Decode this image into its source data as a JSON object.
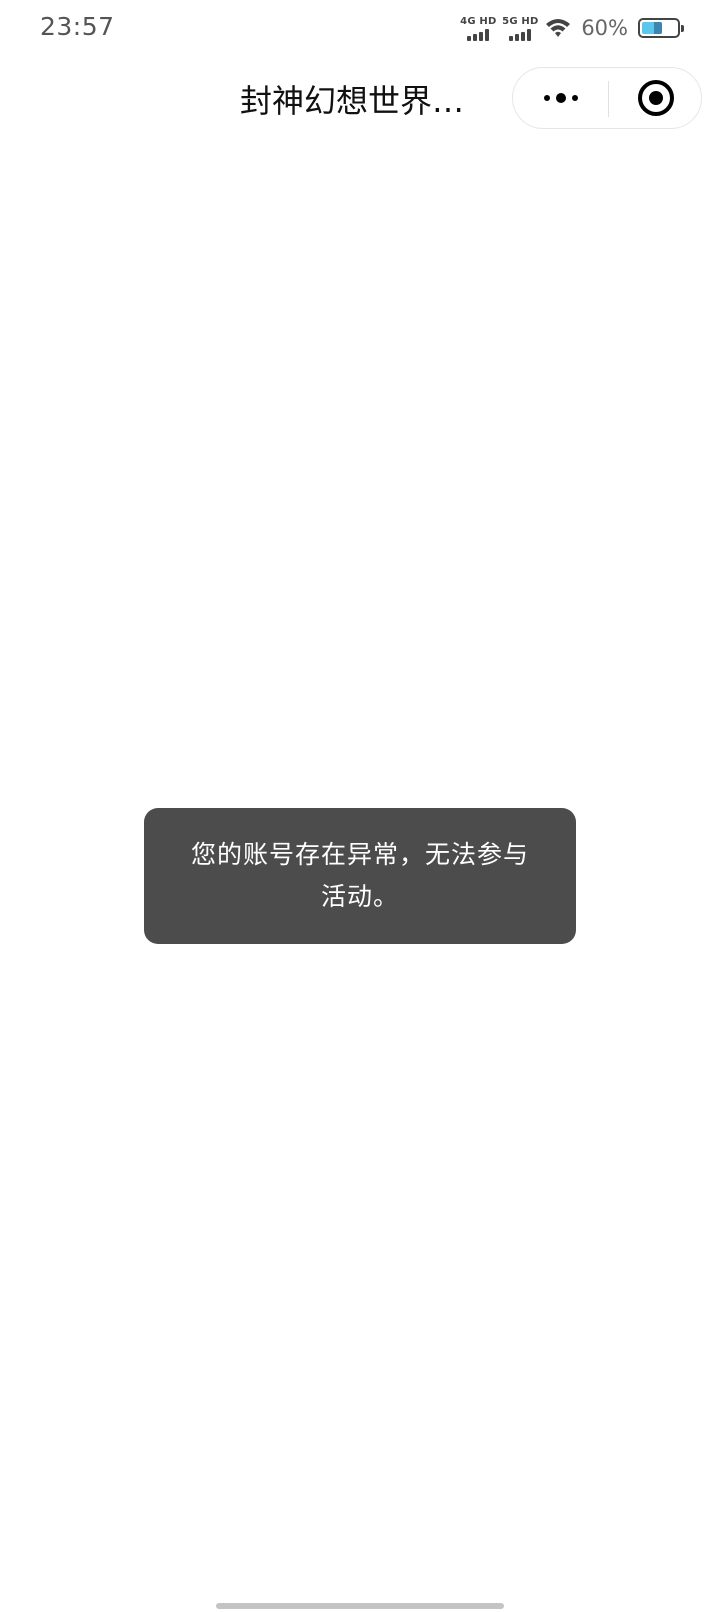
{
  "status_bar": {
    "time": "23:57",
    "sim1_label": "4G HD",
    "sim2_label": "5G HD",
    "battery_percent_text": "60%",
    "battery_level": 0.6,
    "icons": [
      "signal-icon",
      "signal-icon",
      "wifi-icon",
      "battery-icon"
    ]
  },
  "nav_bar": {
    "title": "封神幻想世界…",
    "icons": [
      "more-icon",
      "close-miniprogram-icon"
    ]
  },
  "toast": {
    "message": "您的账号存在异常，无法参与活动。",
    "background_color": "#4c4c4c"
  }
}
